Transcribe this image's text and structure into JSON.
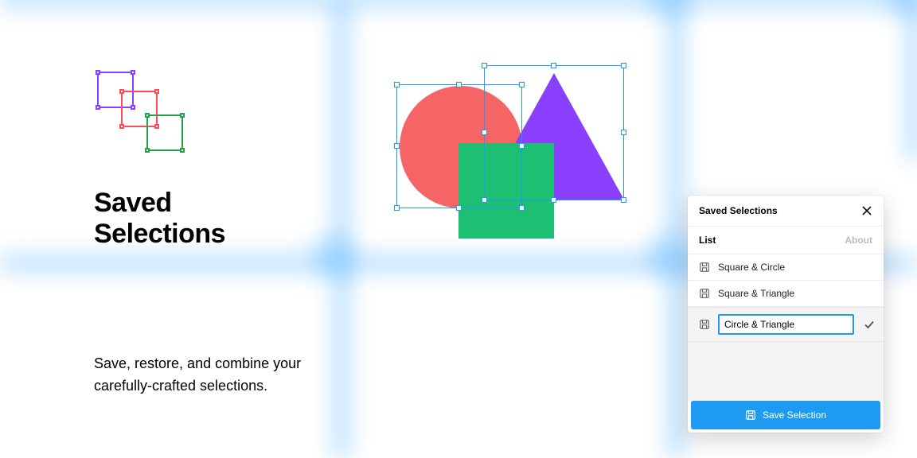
{
  "hero": {
    "title_line1": "Saved",
    "title_line2": "Selections",
    "description": "Save, restore, and combine your carefully-crafted selections."
  },
  "panel": {
    "title": "Saved Selections",
    "tabs": {
      "list": "List",
      "about": "About"
    },
    "items": [
      {
        "label": "Square & Circle"
      },
      {
        "label": "Square & Triangle"
      }
    ],
    "editing": {
      "value": "Circle & Triangle"
    },
    "save_button": "Save Selection"
  },
  "colors": {
    "accent": "#1e9bf0",
    "purple": "#8a3ffc",
    "red": "#f56565",
    "green": "#1dbf73"
  }
}
